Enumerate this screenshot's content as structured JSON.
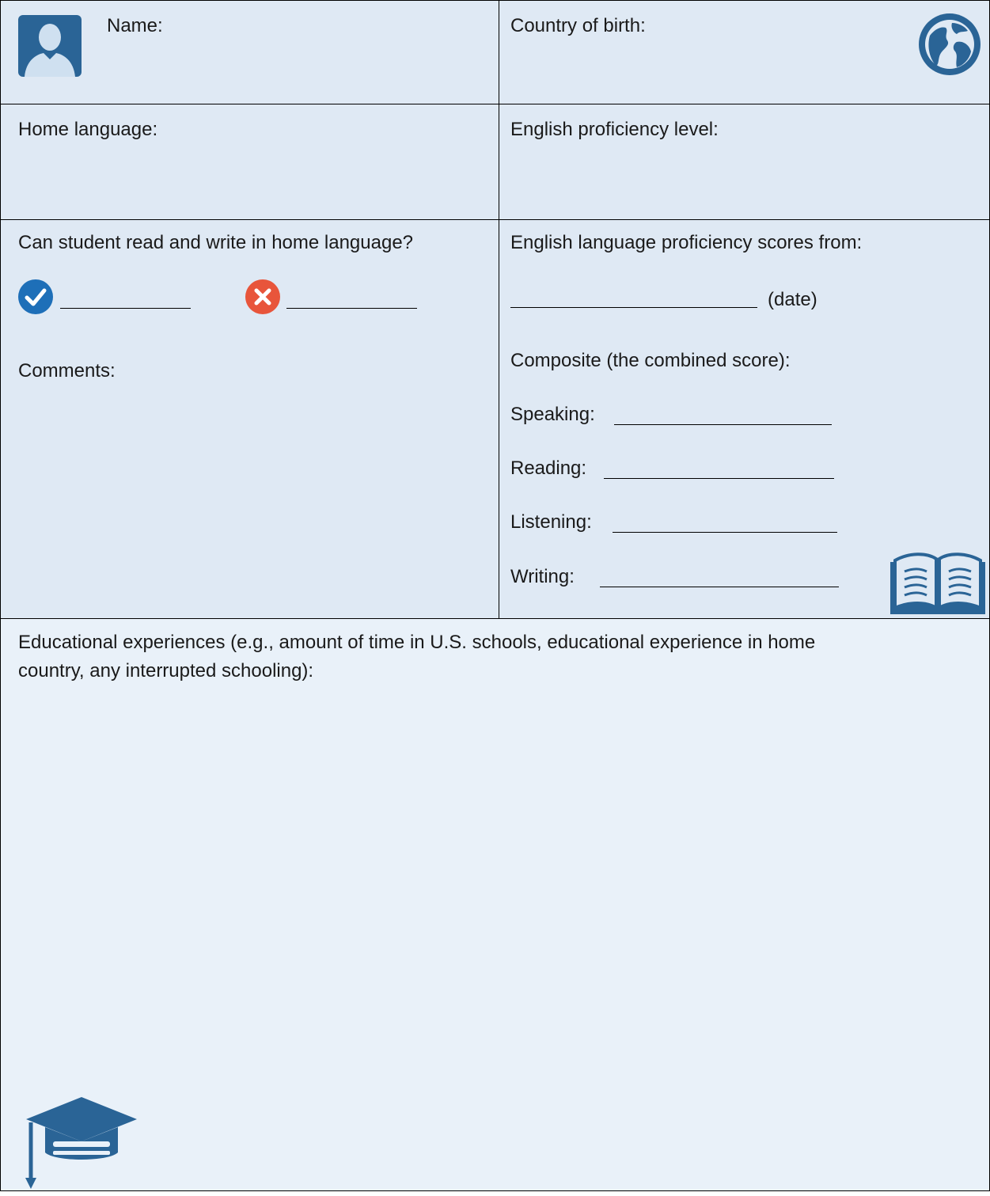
{
  "colors": {
    "cell_fill": "#dfe9f4",
    "cell_fill_light": "#e9f1f9",
    "icon_blue": "#2a6496",
    "check_blue": "#1e6fb8",
    "cross_red": "#e8553b"
  },
  "row1": {
    "name_label": "Name:",
    "avatar_icon": "user-avatar-icon",
    "country_label": "Country of birth:",
    "globe_icon": "globe-icon"
  },
  "row2": {
    "home_language_label": "Home language:",
    "english_level_label": "English proficiency level:"
  },
  "row3": {
    "read_write_question": "Can student read and write in home language?",
    "yes_icon": "check-circle-icon",
    "no_icon": "x-circle-icon",
    "comments_label": "Comments:",
    "scores_from_label": "English language proficiency scores from:",
    "date_label": "(date)",
    "composite_label": "Composite (the combined score):",
    "speaking_label": "Speaking:",
    "reading_label": "Reading:",
    "listening_label": "Listening:",
    "writing_label": "Writing:",
    "book_icon": "open-book-icon"
  },
  "row4": {
    "educational_label_line1": "Educational experiences (e.g., amount of time in U.S. schools, educational experience in home",
    "educational_label_line2": "country, any interrupted schooling):",
    "cap_icon": "graduation-cap-icon"
  }
}
